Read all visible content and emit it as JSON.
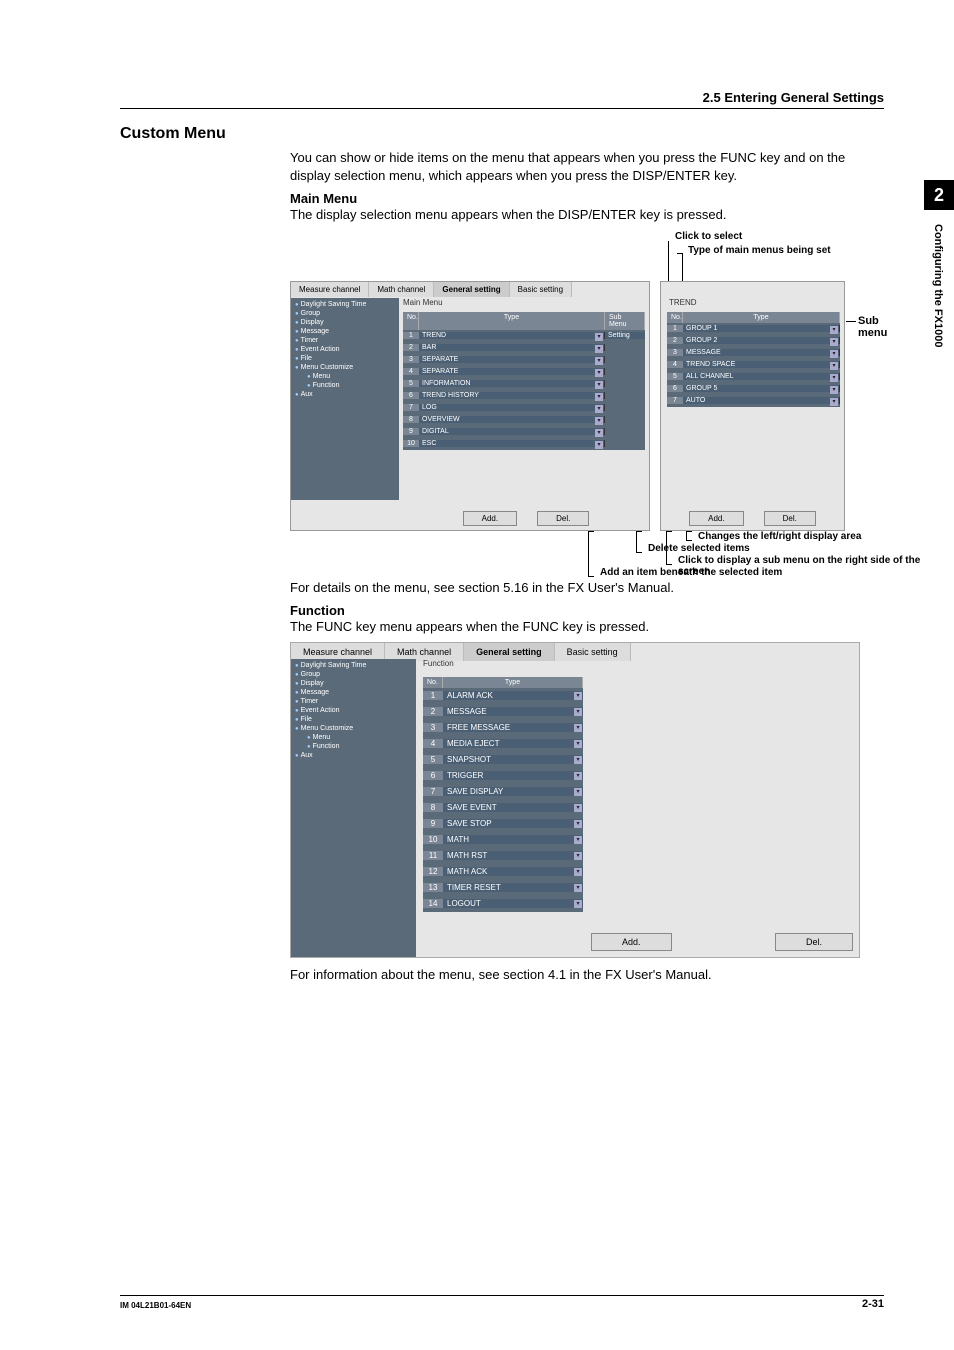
{
  "section_number_label": "2.5 Entering General Settings",
  "h1": "Custom Menu",
  "intro": "You can show or hide items on the menu that appears when you press the FUNC key and on the display selection menu, which appears when you press the DISP/ENTER key.",
  "main_menu_heading": "Main Menu",
  "main_menu_desc": "The display selection menu appears when the DISP/ENTER key is pressed.",
  "fig1_callouts": {
    "click_to_select": "Click to select",
    "type_of_main": "Type of main menus being set",
    "sub_menu": "Sub menu",
    "changes": "Changes the left/right display area",
    "delete": "Delete selected items",
    "click_sub": "Click to display a sub menu on the right side of the screen",
    "add_item": "Add an item beneath the selected item"
  },
  "fig1_after": "For details on the menu, see section 5.16 in the FX User's Manual.",
  "function_heading": "Function",
  "function_desc": "The FUNC key menu appears when the FUNC key is pressed.",
  "fig2_after": "For information about the menu, see section 4.1 in the FX User's Manual.",
  "tabs": [
    "Measure channel",
    "Math channel",
    "General setting",
    "Basic setting"
  ],
  "tree_items": [
    {
      "label": "Daylight Saving Time",
      "indent": false
    },
    {
      "label": "Group",
      "indent": false
    },
    {
      "label": "Display",
      "indent": false
    },
    {
      "label": "Message",
      "indent": false
    },
    {
      "label": "Timer",
      "indent": false
    },
    {
      "label": "Event Action",
      "indent": false
    },
    {
      "label": "File",
      "indent": false
    },
    {
      "label": "Menu Customize",
      "indent": false
    },
    {
      "label": "Menu",
      "indent": true
    },
    {
      "label": "Function",
      "indent": true
    },
    {
      "label": "Aux",
      "indent": false
    }
  ],
  "fig1_left": {
    "group_label": "Main Menu",
    "headers": {
      "no": "No.",
      "type": "Type",
      "sub": "Sub Menu"
    },
    "rows": [
      {
        "n": "1",
        "type": "TREND",
        "sub": "Setting"
      },
      {
        "n": "2",
        "type": "BAR",
        "sub": ""
      },
      {
        "n": "3",
        "type": "SEPARATE",
        "sub": ""
      },
      {
        "n": "4",
        "type": "SEPARATE",
        "sub": ""
      },
      {
        "n": "5",
        "type": "INFORMATION",
        "sub": ""
      },
      {
        "n": "6",
        "type": "TREND HISTORY",
        "sub": ""
      },
      {
        "n": "7",
        "type": "LOG",
        "sub": ""
      },
      {
        "n": "8",
        "type": "OVERVIEW",
        "sub": ""
      },
      {
        "n": "9",
        "type": "DIGITAL",
        "sub": ""
      },
      {
        "n": "10",
        "type": "ESC",
        "sub": ""
      }
    ],
    "add_btn": "Add.",
    "del_btn": "Del."
  },
  "fig1_right": {
    "group_label": "TREND",
    "headers": {
      "no": "No.",
      "type": "Type"
    },
    "rows": [
      {
        "n": "1",
        "type": "GROUP 1"
      },
      {
        "n": "2",
        "type": "GROUP 2"
      },
      {
        "n": "3",
        "type": "MESSAGE"
      },
      {
        "n": "4",
        "type": "TREND SPACE"
      },
      {
        "n": "5",
        "type": "ALL CHANNEL"
      },
      {
        "n": "6",
        "type": "GROUP 5"
      },
      {
        "n": "7",
        "type": "AUTO"
      }
    ],
    "add_btn": "Add.",
    "del_btn": "Del."
  },
  "fig2": {
    "group_label": "Function",
    "headers": {
      "no": "No.",
      "type": "Type"
    },
    "rows": [
      {
        "n": "1",
        "type": "ALARM ACK"
      },
      {
        "n": "2",
        "type": "MESSAGE"
      },
      {
        "n": "3",
        "type": "FREE MESSAGE"
      },
      {
        "n": "4",
        "type": "MEDIA EJECT"
      },
      {
        "n": "5",
        "type": "SNAPSHOT"
      },
      {
        "n": "6",
        "type": "TRIGGER"
      },
      {
        "n": "7",
        "type": "SAVE DISPLAY"
      },
      {
        "n": "8",
        "type": "SAVE EVENT"
      },
      {
        "n": "9",
        "type": "SAVE STOP"
      },
      {
        "n": "10",
        "type": "MATH"
      },
      {
        "n": "11",
        "type": "MATH RST"
      },
      {
        "n": "12",
        "type": "MATH ACK"
      },
      {
        "n": "13",
        "type": "TIMER RESET"
      },
      {
        "n": "14",
        "type": "LOGOUT"
      }
    ],
    "add_btn": "Add.",
    "del_btn": "Del."
  },
  "side_tab": {
    "chapter_num": "2",
    "chapter_title": "Configuring the FX1000"
  },
  "footer": {
    "left": "IM 04L21B01-64EN",
    "right": "2-31"
  }
}
